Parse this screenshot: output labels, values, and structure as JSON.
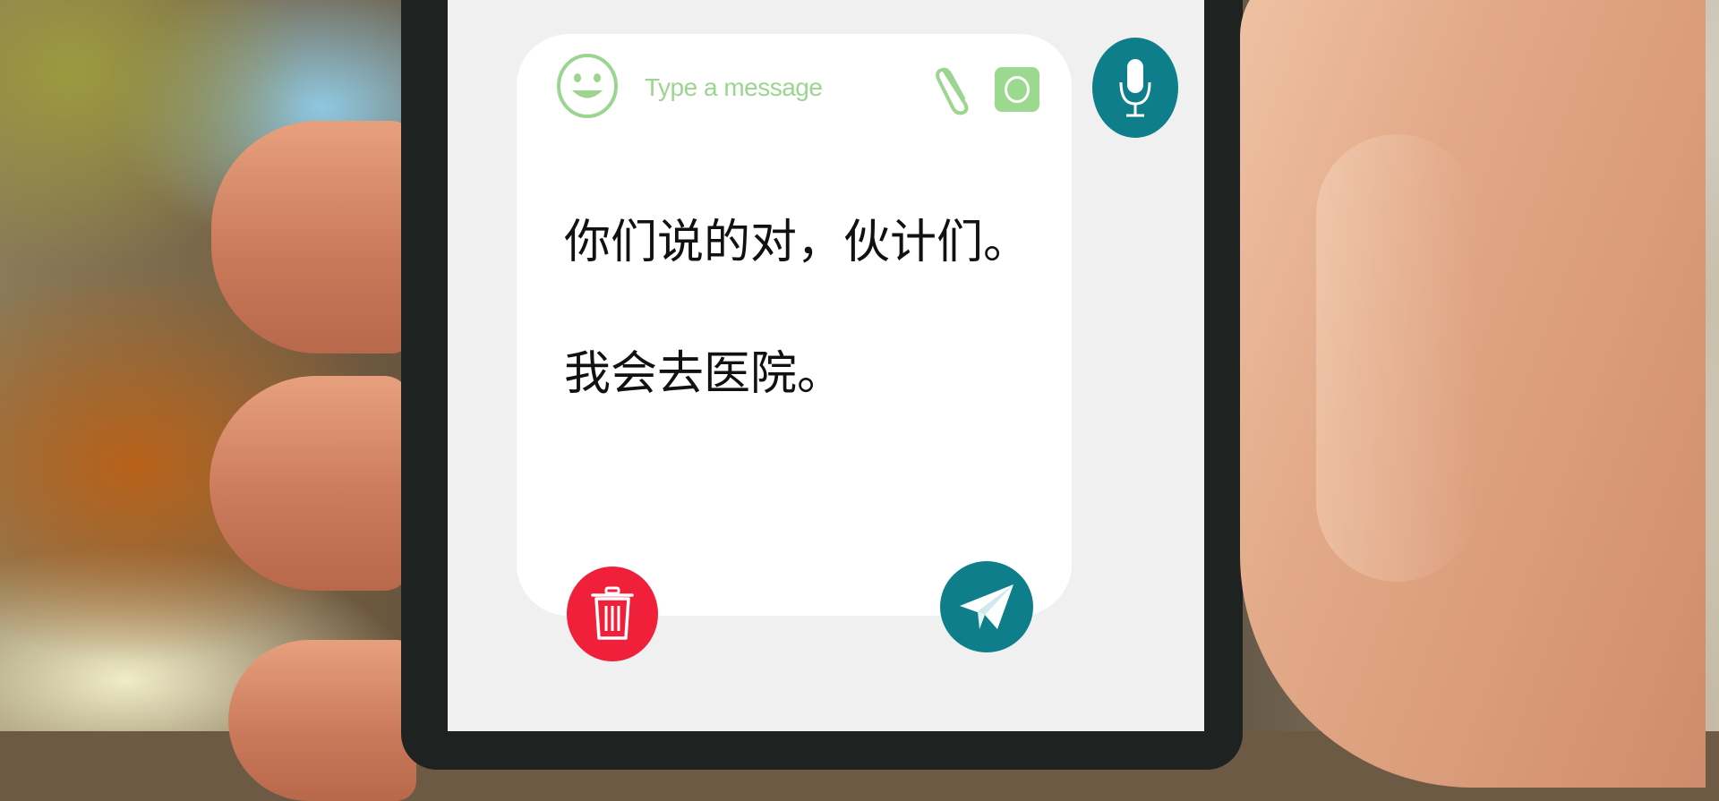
{
  "composer": {
    "placeholder": "Type a message",
    "message_lines": [
      "你们说的对，伙计们。",
      "我会去医院。"
    ]
  },
  "icons": {
    "emoji": "smiley-face-icon",
    "attach": "paperclip-icon",
    "camera": "camera-icon",
    "mic": "microphone-icon",
    "delete": "trash-icon",
    "send": "paper-plane-icon"
  },
  "colors": {
    "accent_teal": "#0e7f8a",
    "accent_green": "#9bd98f",
    "delete_red": "#f0203a",
    "screen_bg": "#f0f0f0",
    "card_bg": "#ffffff"
  }
}
